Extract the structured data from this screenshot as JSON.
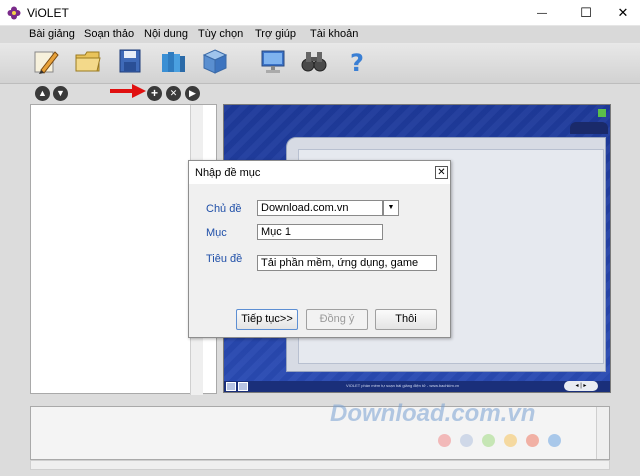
{
  "window": {
    "title": "ViOLET",
    "minimize_glyph": "—",
    "maximize_glyph": "☐",
    "close_glyph": "✕"
  },
  "menu": {
    "items": [
      {
        "label": "Bài giảng"
      },
      {
        "label": "Soạn thảo"
      },
      {
        "label": "Nội dung"
      },
      {
        "label": "Tùy chọn"
      },
      {
        "label": "Trợ giúp"
      },
      {
        "label": "Tài khoản"
      }
    ]
  },
  "toolbar": {
    "icons": [
      "pencil-icon",
      "folder-icon",
      "save-disk-icon",
      "books-icon",
      "cube-icon",
      "monitor-icon",
      "binoculars-icon",
      "help-question-icon"
    ]
  },
  "outline_controls": {
    "up_glyph": "▲",
    "down_glyph": "▼",
    "add_glyph": "+",
    "delete_glyph": "✕",
    "right_glyph": "▶"
  },
  "preview": {
    "footer_text": "VIOLET phần mềm tự soạn bài giảng điện tử - www.bachkim.vn",
    "nav_label": "◂ | ▸"
  },
  "dialog": {
    "title": "Nhập đề mục",
    "close_glyph": "✕",
    "fields": {
      "chu_de_label": "Chủ đề",
      "chu_de_value": "Download.com.vn",
      "muc_label": "Mục",
      "muc_value": "Mục 1",
      "tieu_de_label": "Tiêu đề",
      "tieu_de_value": "Tải phần mềm, ứng dụng, game"
    },
    "dropdown_glyph": "▼",
    "buttons": {
      "continue": "Tiếp tục>>",
      "ok": "Đồng ý",
      "cancel": "Thôi"
    }
  },
  "watermark": {
    "text": "Download.com.vn"
  },
  "colors": {
    "accent_label": "#1f4fa8",
    "preview_bg": "#1e3a9a",
    "arrow": "#e01010"
  }
}
